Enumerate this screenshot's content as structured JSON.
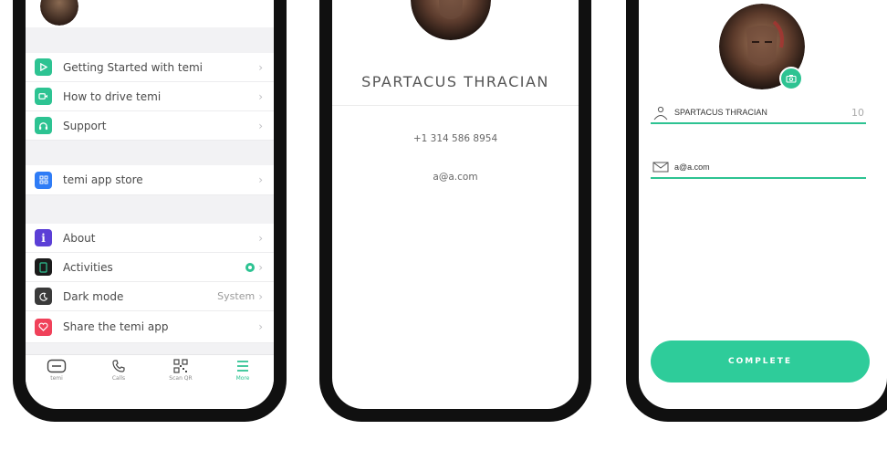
{
  "menu_screen": {
    "items": [
      {
        "label": "Getting Started with temi",
        "icon": "play-icon",
        "color": "#2dc392"
      },
      {
        "label": "How to drive temi",
        "icon": "video-icon",
        "color": "#2dc392"
      },
      {
        "label": "Support",
        "icon": "headset-icon",
        "color": "#2dc392"
      },
      {
        "label": "temi app store",
        "icon": "app-grid-icon",
        "color": "#2f7cf6"
      },
      {
        "label": "About",
        "icon": "info-icon",
        "color": "#5b3fd6"
      },
      {
        "label": "Activities",
        "icon": "activities-icon",
        "color": "#1b1b1b"
      },
      {
        "label": "Dark mode",
        "icon": "moon-icon",
        "color": "#3a3a3a",
        "value": "System"
      },
      {
        "label": "Share the temi app",
        "icon": "heart-icon",
        "color": "#f0415a"
      }
    ],
    "tabs": [
      {
        "label": "temi",
        "icon": "robot-face-icon"
      },
      {
        "label": "Calls",
        "icon": "phone-icon"
      },
      {
        "label": "Scan QR",
        "icon": "qr-code-icon"
      },
      {
        "label": "More",
        "icon": "menu-icon",
        "active": true
      }
    ],
    "accent_color": "#2dc392"
  },
  "profile_screen": {
    "name": "SPARTACUS THRACIAN",
    "phone": "+1 314 586 8954",
    "email": "a@a.com"
  },
  "edit_screen": {
    "name_value": "SPARTACUS THRACIAN",
    "name_counter": "10",
    "email_value": "a@a.com",
    "complete_label": "COMPLETE",
    "button_color": "#2ecc9a"
  }
}
